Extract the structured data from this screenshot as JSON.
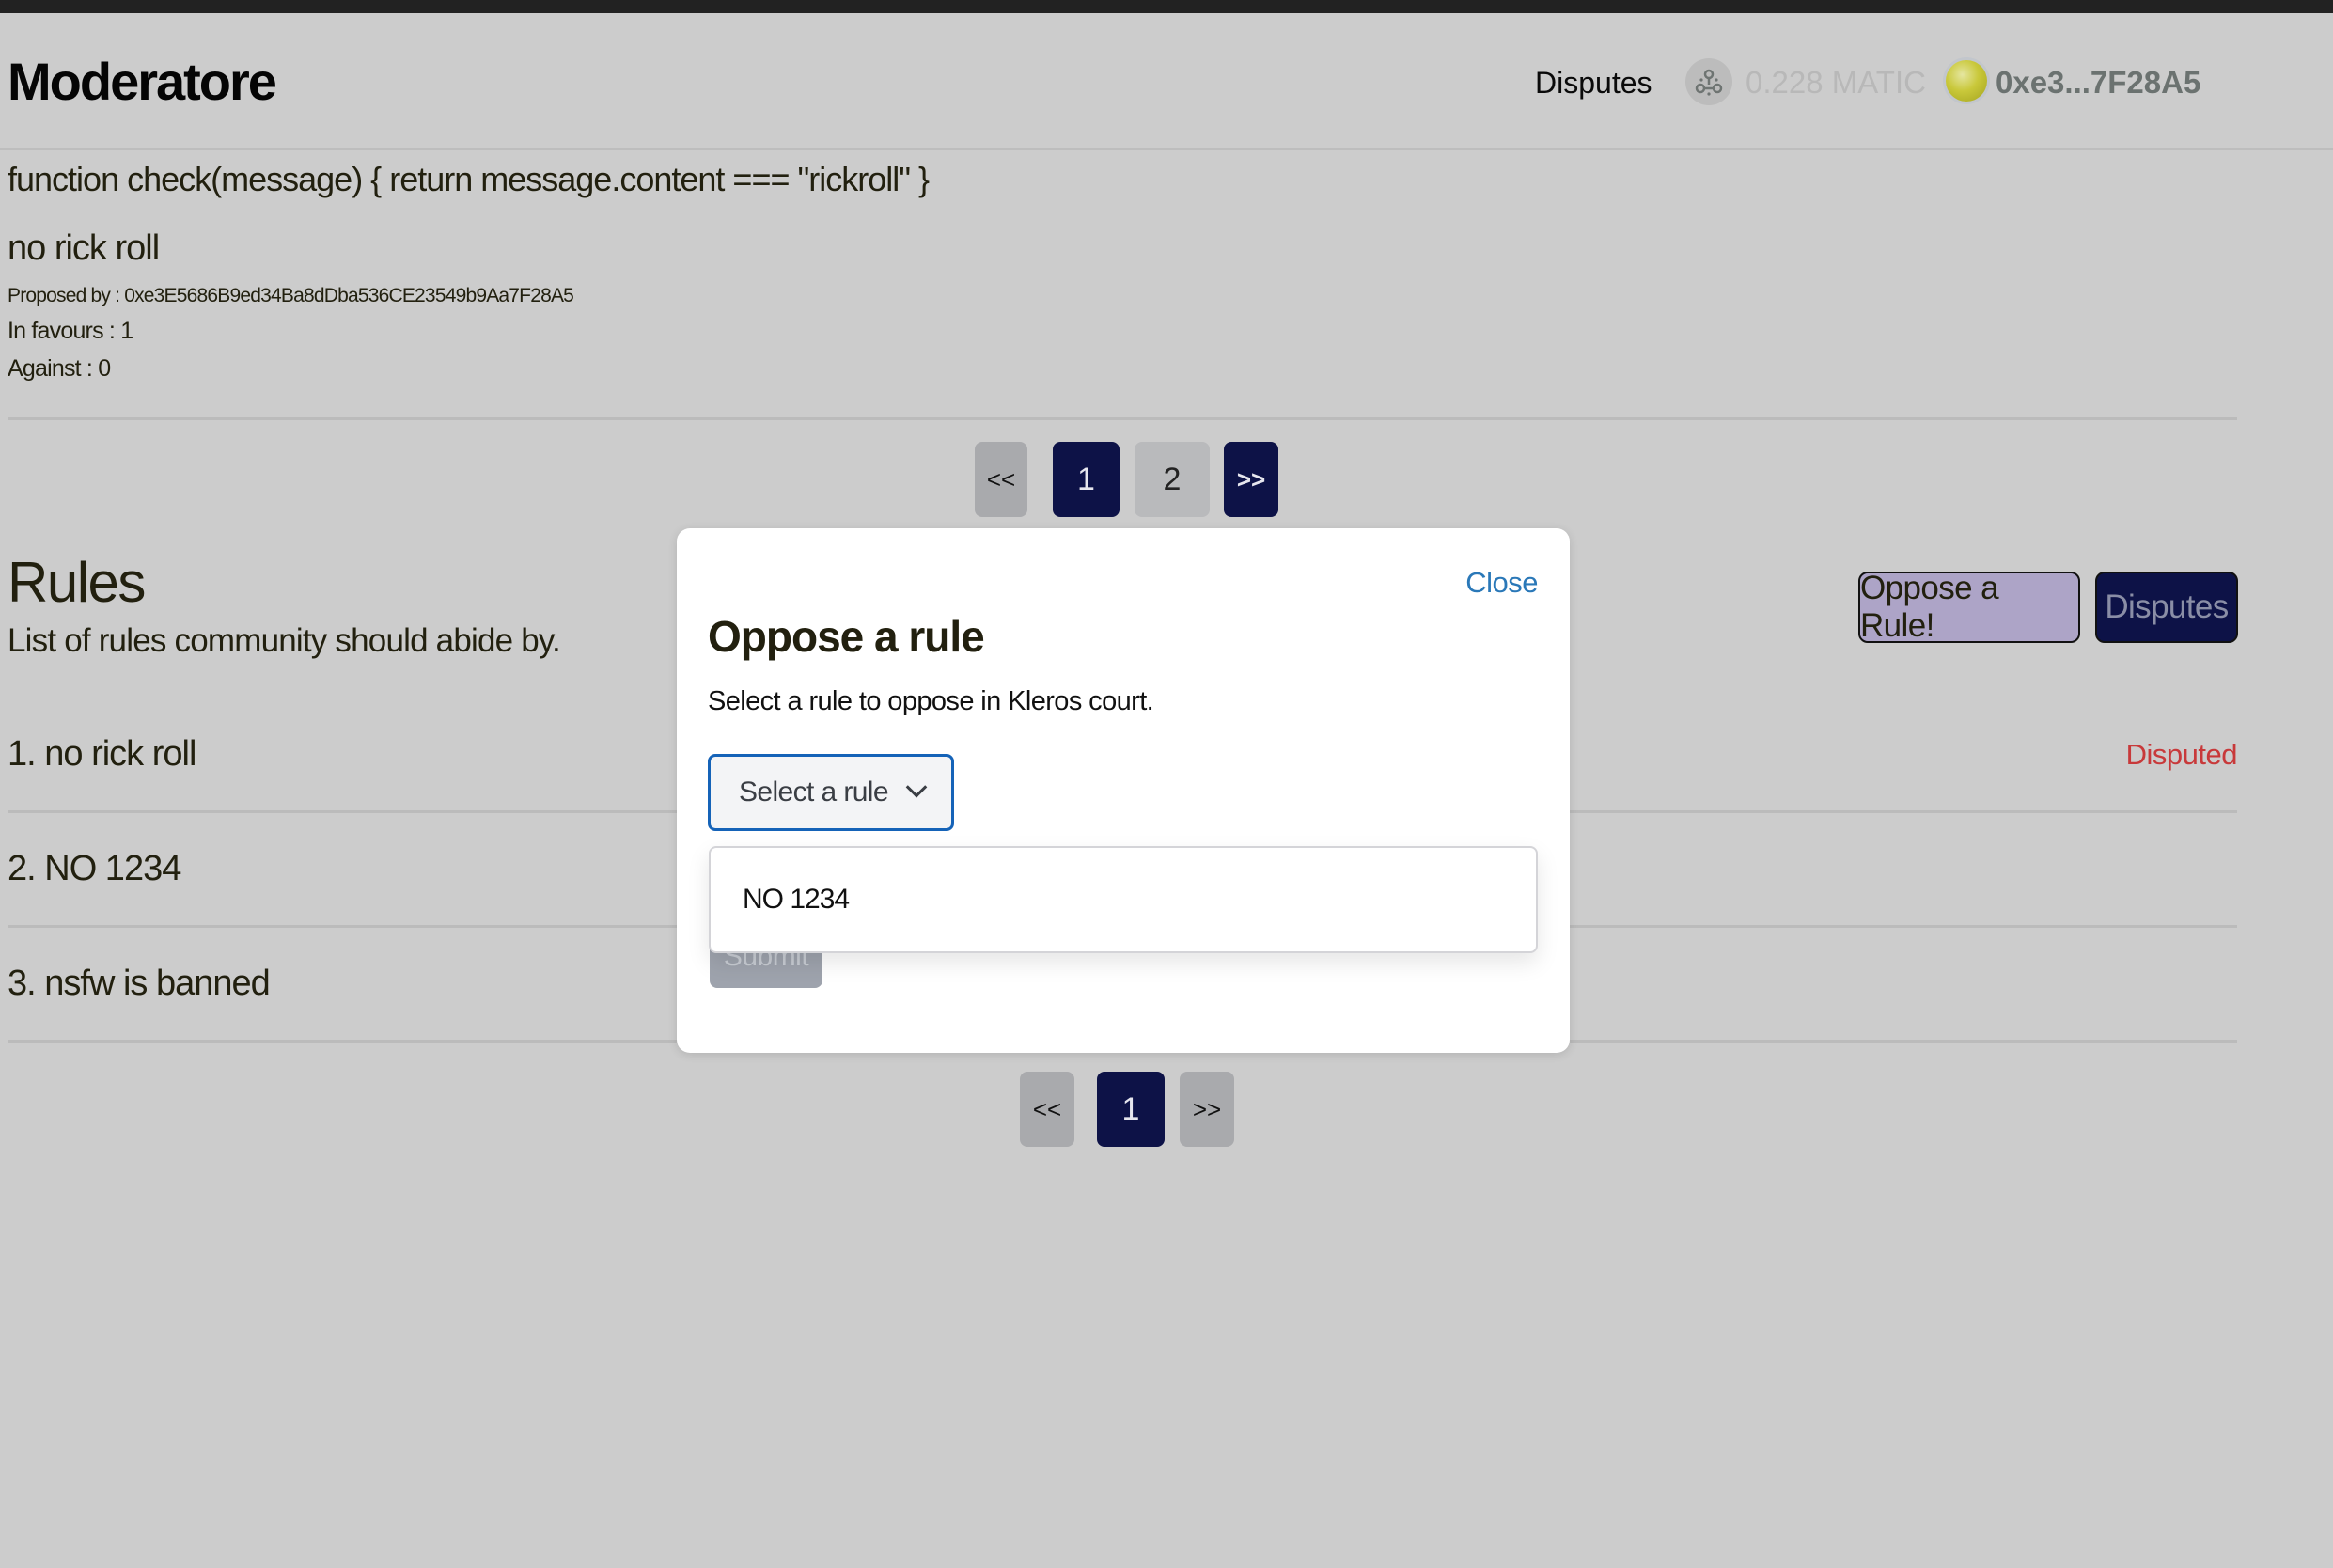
{
  "header": {
    "brand": "Moderatore",
    "nav_disputes": "Disputes",
    "network_icon": "polygon-network-icon",
    "balance": "0.228 MATIC",
    "avatar_icon": "wallet-avatar-icon",
    "address": "0xe3...7F28A5"
  },
  "proposal": {
    "function_code": "function check(message) { return message.content === \"rickroll\" }",
    "title": "no rick roll",
    "proposed_by": "Proposed by : 0xe3E5686B9ed34Ba8dDba536CE23549b9Aa7F28A5",
    "in_favour": "In favours : 1",
    "against": "Against : 0"
  },
  "proposal_pagination": {
    "prev": "<<",
    "pages": [
      "1",
      "2"
    ],
    "current": "1",
    "next": ">>"
  },
  "rules": {
    "title": "Rules",
    "subtitle": "List of rules community should abide by.",
    "oppose_button": "Oppose a Rule!",
    "disputes_button": "Disputes",
    "items": [
      {
        "label": "1. no rick roll",
        "status": "Disputed"
      },
      {
        "label": "2. NO 1234",
        "status": ""
      },
      {
        "label": "3. nsfw is banned",
        "status": ""
      }
    ],
    "status_color": "#c8393a"
  },
  "rules_pagination": {
    "prev": "<<",
    "pages": [
      "1"
    ],
    "current": "1",
    "next": ">>"
  },
  "modal": {
    "close": "Close",
    "title": "Oppose a rule",
    "description": "Select a rule to oppose in Kleros court.",
    "select_placeholder": "Select a rule",
    "options": [
      "NO 1234"
    ],
    "submit": "Submit"
  },
  "colors": {
    "accent_dark": "#0d1247",
    "oppose_button": "#ada4c7",
    "link": "#2a78b8",
    "select_border": "#1563b8"
  }
}
